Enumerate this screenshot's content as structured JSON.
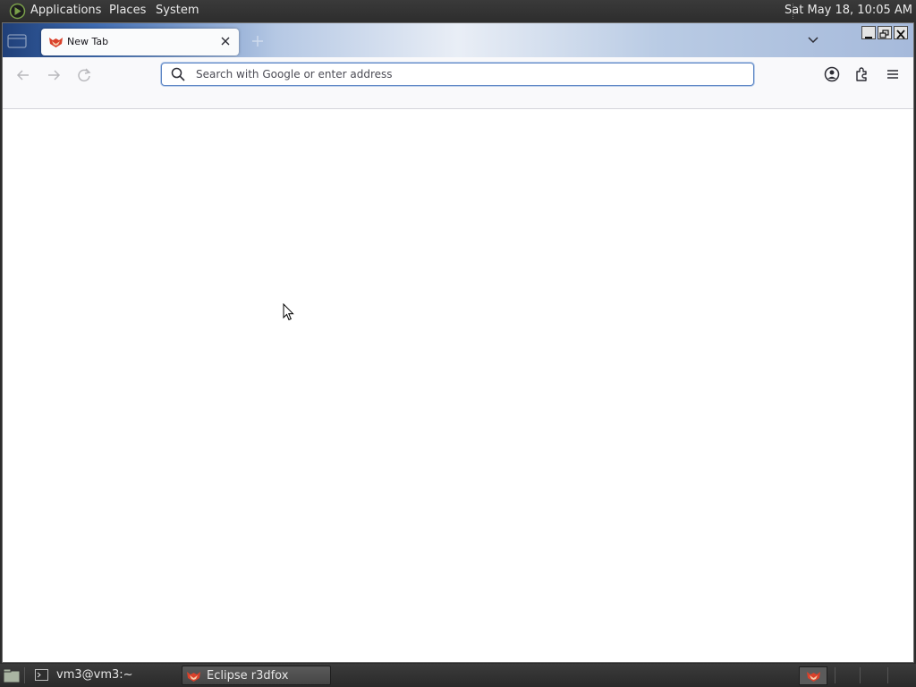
{
  "top_panel": {
    "menus": [
      "Applications",
      "Places",
      "System"
    ],
    "clock": "Sat May 18, 10:05 AM"
  },
  "browser": {
    "tab": {
      "title": "New Tab"
    },
    "urlbar": {
      "placeholder": "Search with Google or enter address",
      "value": ""
    },
    "accent_color": "#5b84c4"
  },
  "taskbar": {
    "tasks": [
      {
        "label": "vm3@vm3:~",
        "active": false
      },
      {
        "label": "Eclipse r3dfox",
        "active": true
      }
    ]
  }
}
